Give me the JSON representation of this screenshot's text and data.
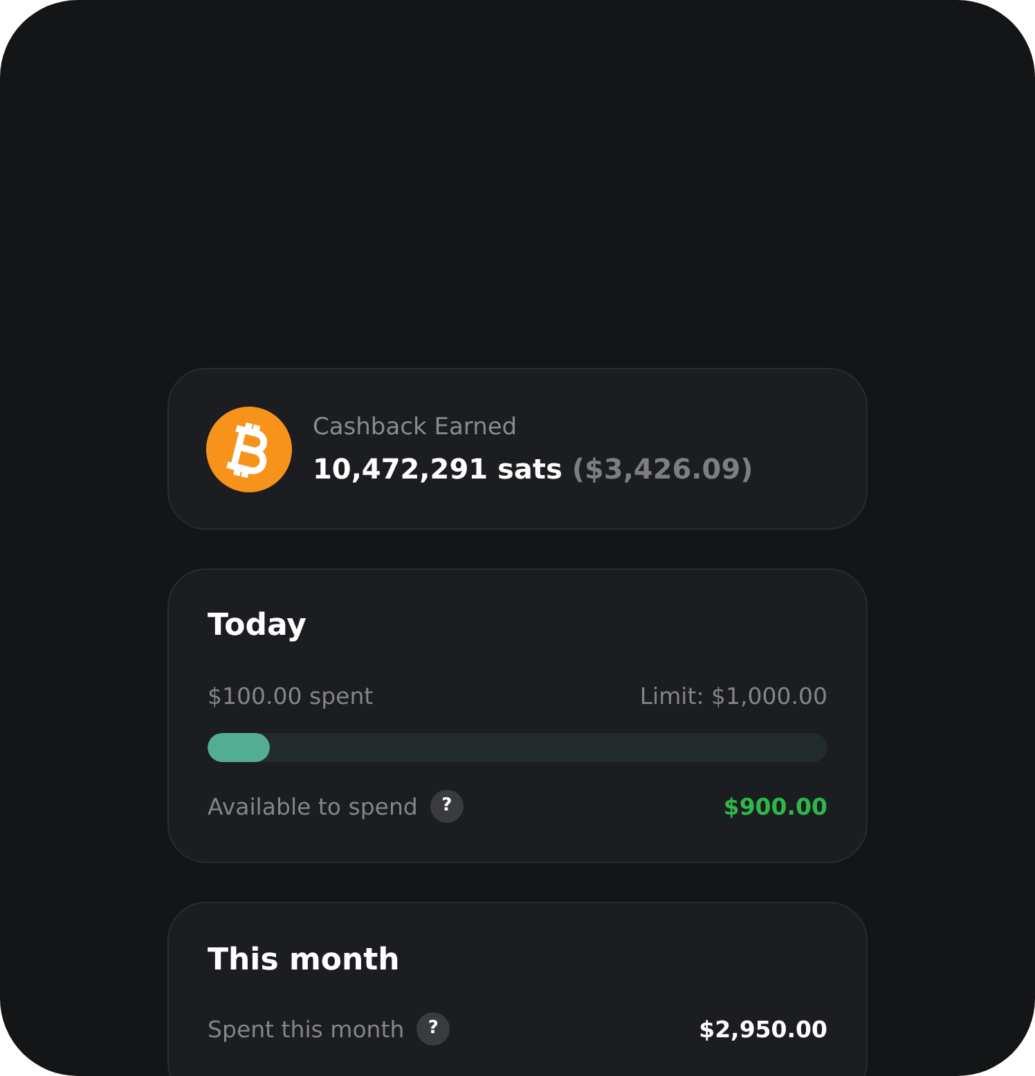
{
  "cashback": {
    "label": "Cashback Earned",
    "sats": "10,472,291 sats",
    "usd": "($3,426.09)"
  },
  "today": {
    "title": "Today",
    "spent": "$100.00 spent",
    "limit": "Limit: $1,000.00",
    "level": 0.1,
    "available_label": "Available to spend",
    "help": "?",
    "available": "$900.00"
  },
  "month": {
    "title": "This month",
    "rows": [
      {
        "label": "Spent this month",
        "help": "?",
        "value": "$2,950.00"
      }
    ]
  }
}
